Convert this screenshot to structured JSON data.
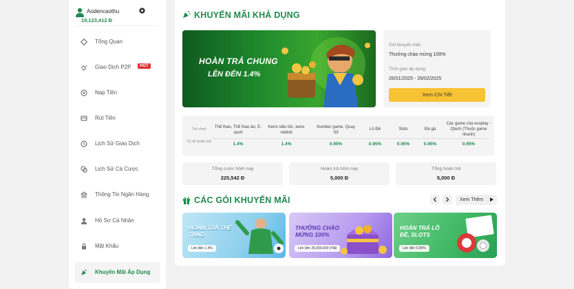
{
  "user": {
    "name": "Aodencaothu",
    "balance": "19,123,412 Đ"
  },
  "sidebar": {
    "items": [
      {
        "label": "Tổng Quan",
        "icon": "grid-icon"
      },
      {
        "label": "Giao Dịch P2P",
        "icon": "handshake-icon",
        "badge": "HOT"
      },
      {
        "label": "Nạp Tiền",
        "icon": "deposit-icon"
      },
      {
        "label": "Rút Tiền",
        "icon": "withdraw-icon"
      },
      {
        "label": "Lịch Sử Giao Dịch",
        "icon": "history-icon"
      },
      {
        "label": "Lịch Sử Cá Cược",
        "icon": "bet-history-icon"
      },
      {
        "label": "Thông Tin Ngân Hàng",
        "icon": "bank-icon"
      },
      {
        "label": "Hồ Sơ Cá Nhân",
        "icon": "profile-icon"
      },
      {
        "label": "Mật Khẩu",
        "icon": "lock-icon"
      },
      {
        "label": "Khuyến Mãi Áp Dụng",
        "icon": "promo-icon",
        "active": true
      }
    ]
  },
  "main": {
    "title": "KHUYẾN MÃI KHẢ DỤNG",
    "hero": {
      "line1": "HOÀN TRẢ CHUNG",
      "line2": "LÊN ĐẾN 1.4%"
    },
    "info": {
      "package_label": "Gói khuyến mãi:",
      "package_value": "Thưởng chào mừng 100%",
      "time_label": "Thời gian áp dụng:",
      "time_value": "26/01/2025 - 26/02/2025",
      "button": "Xem Chi Tiết"
    },
    "rates": {
      "head_label": "Trò chơi",
      "row_label": "Tỷ lệ hoàn trả",
      "columns": [
        {
          "name": "Thể thao, Thể thao ảo, E-sport",
          "rate": "1.4%"
        },
        {
          "name": "Keno siêu tốc, keno vietlott",
          "rate": "1.4%"
        },
        {
          "name": "Number game, Quay Số",
          "rate": "0.95%"
        },
        {
          "name": "Lô Đề",
          "rate": "0.95%"
        },
        {
          "name": "Slots",
          "rate": "0.95%"
        },
        {
          "name": "Đá gà",
          "rate": "0.95%"
        },
        {
          "name": "Các game của evoplay - Qtech (Thuộc game nhanh)",
          "rate": "0.95%"
        }
      ]
    },
    "stats": [
      {
        "label": "Tổng cược hôm nay",
        "value": "225,542 Đ"
      },
      {
        "label": "Hoàn trả hôm nay",
        "value": "5,000 Đ"
      },
      {
        "label": "Tổng hoàn trả",
        "value": "5,000 Đ"
      }
    ],
    "packages_title": "CÁC GÓI KHUYẾN MÃI",
    "more_label": "Xem Thêm",
    "cards": [
      {
        "title": "HOÀN TRẢ THỂ THAO",
        "sub": "Lên đến 1.4%"
      },
      {
        "title": "THƯỞNG CHÀO MỪNG 100%",
        "sub": "Lên đến 25,000,000 VNĐ"
      },
      {
        "title": "HOÀN TRẢ LÔ ĐỀ, SLOTS",
        "sub": "Lên đến 0.95%"
      }
    ]
  },
  "colors": {
    "accent": "#1f8a4c",
    "button": "#f7c233",
    "hot": "#e03030"
  }
}
